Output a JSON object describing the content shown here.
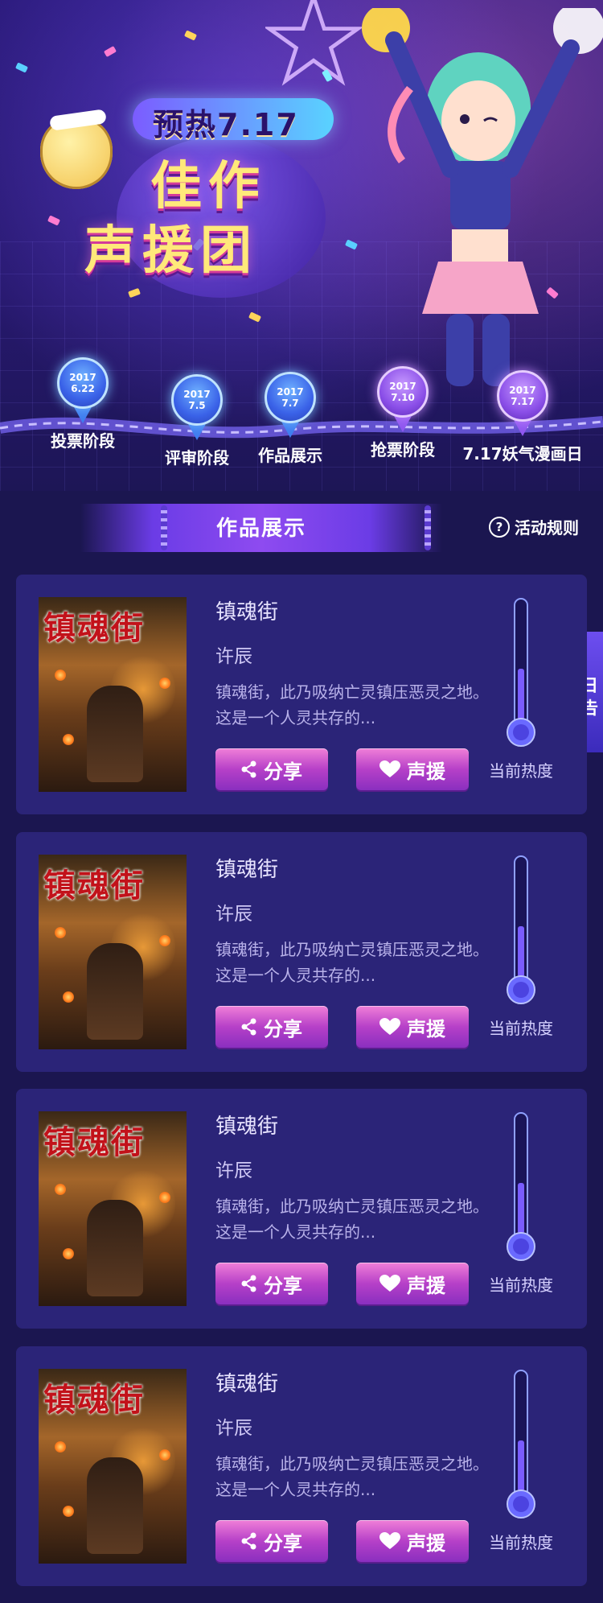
{
  "hero": {
    "pill": "预热7.17",
    "title_line1": "佳作",
    "title_line2": "声援团"
  },
  "timeline": [
    {
      "date_year": "2017",
      "date_md": "6.22",
      "label": "投票阶段"
    },
    {
      "date_year": "2017",
      "date_md": "7.5",
      "label": "评审阶段"
    },
    {
      "date_year": "2017",
      "date_md": "7.7",
      "label": "作品展示"
    },
    {
      "date_year": "2017",
      "date_md": "7.10",
      "label": "抢票阶段"
    },
    {
      "date_year": "2017",
      "date_md": "7.17",
      "label": "7.17妖气漫画日"
    }
  ],
  "section": {
    "title": "作品展示",
    "rules": "活动规则"
  },
  "side_tab": {
    "line1": "明日",
    "line2": "预告"
  },
  "cards": [
    {
      "cover_text": "镇魂街",
      "title": "镇魂街",
      "author": "许辰",
      "desc": "镇魂街，此乃吸纳亡灵镇压恶灵之地。这是一个人灵共存的...",
      "share": "分享",
      "cheer": "声援",
      "heat_label": "当前热度",
      "heat": 0.45
    },
    {
      "cover_text": "镇魂街",
      "title": "镇魂街",
      "author": "许辰",
      "desc": "镇魂街，此乃吸纳亡灵镇压恶灵之地。这是一个人灵共存的...",
      "share": "分享",
      "cheer": "声援",
      "heat_label": "当前热度",
      "heat": 0.45
    },
    {
      "cover_text": "镇魂街",
      "title": "镇魂街",
      "author": "许辰",
      "desc": "镇魂街，此乃吸纳亡灵镇压恶灵之地。这是一个人灵共存的...",
      "share": "分享",
      "cheer": "声援",
      "heat_label": "当前热度",
      "heat": 0.45
    },
    {
      "cover_text": "镇魂街",
      "title": "镇魂街",
      "author": "许辰",
      "desc": "镇魂街，此乃吸纳亡灵镇压恶灵之地。这是一个人灵共存的...",
      "share": "分享",
      "cheer": "声援",
      "heat_label": "当前热度",
      "heat": 0.45
    }
  ],
  "colors": {
    "background": "#1b1650",
    "card": "#2b2478",
    "button": "#b640c8",
    "pin_blue": "#3a62e8",
    "pin_purple": "#8b4fe8"
  }
}
